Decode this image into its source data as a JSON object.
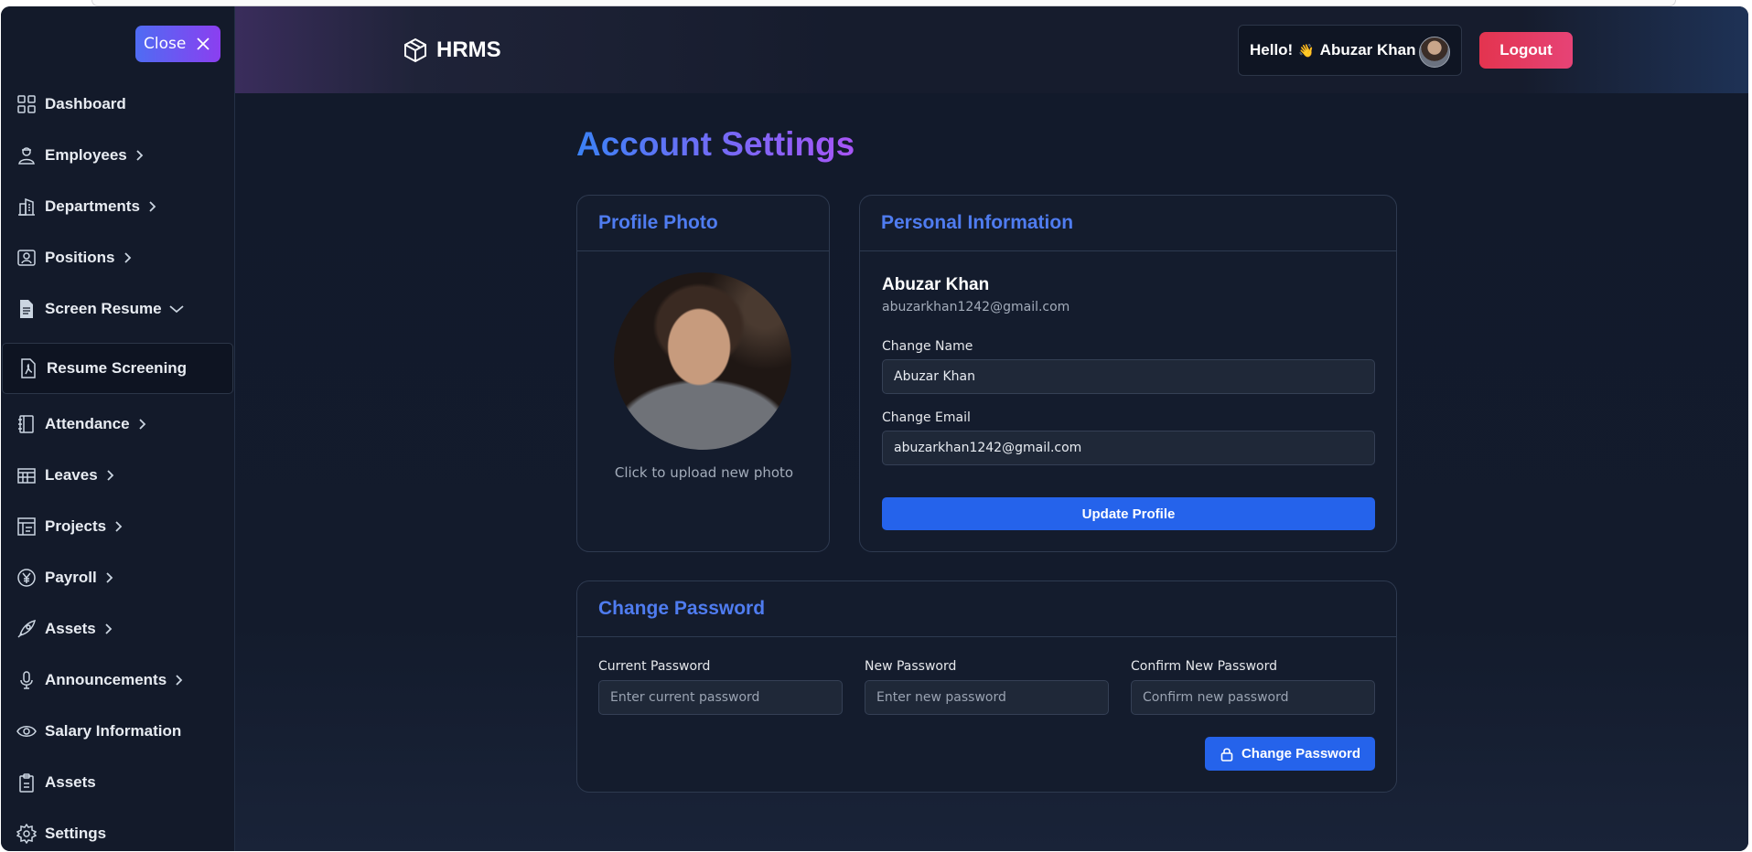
{
  "sidebar": {
    "close_label": "Close",
    "items": [
      {
        "label": "Dashboard",
        "icon": "grid-icon",
        "chevron": ""
      },
      {
        "label": "Employees",
        "icon": "person-icon",
        "chevron": "right"
      },
      {
        "label": "Departments",
        "icon": "building-icon",
        "chevron": "right"
      },
      {
        "label": "Positions",
        "icon": "id-card-icon",
        "chevron": "right"
      },
      {
        "label": "Screen Resume",
        "icon": "document-icon",
        "chevron": "down"
      },
      {
        "label": "Resume Screening",
        "icon": "pdf-icon",
        "chevron": "",
        "active": true
      },
      {
        "label": "Attendance",
        "icon": "notebook-icon",
        "chevron": "right"
      },
      {
        "label": "Leaves",
        "icon": "calendar-icon",
        "chevron": "right"
      },
      {
        "label": "Projects",
        "icon": "project-icon",
        "chevron": "right"
      },
      {
        "label": "Payroll",
        "icon": "yen-icon",
        "chevron": "right"
      },
      {
        "label": "Assets",
        "icon": "rocket-icon",
        "chevron": "right"
      },
      {
        "label": "Announcements",
        "icon": "microphone-icon",
        "chevron": "right"
      },
      {
        "label": "Salary Information",
        "icon": "eye-icon",
        "chevron": ""
      },
      {
        "label": "Assets",
        "icon": "clipboard-icon",
        "chevron": ""
      },
      {
        "label": "Settings",
        "icon": "gear-icon",
        "chevron": ""
      }
    ]
  },
  "header": {
    "brand": "HRMS",
    "greeting": "Hello!",
    "wave": "👋",
    "user_name": "Abuzar Khan",
    "logout_label": "Logout"
  },
  "main": {
    "title": "Account Settings",
    "profile_photo": {
      "title": "Profile Photo",
      "hint": "Click to upload new photo"
    },
    "personal_info": {
      "title": "Personal Information",
      "name": "Abuzar Khan",
      "email": "abuzarkhan1242@gmail.com",
      "change_name_label": "Change Name",
      "change_name_value": "Abuzar Khan",
      "change_email_label": "Change Email",
      "change_email_value": "abuzarkhan1242@gmail.com",
      "update_label": "Update Profile"
    },
    "change_password": {
      "title": "Change Password",
      "current_label": "Current Password",
      "current_placeholder": "Enter current password",
      "new_label": "New Password",
      "new_placeholder": "Enter new password",
      "confirm_label": "Confirm New Password",
      "confirm_placeholder": "Confirm new password",
      "submit_label": "Change Password"
    }
  },
  "colors": {
    "accent_blue": "#2563eb",
    "heading_blue": "#4f7cf0",
    "logout_red": "#e3344f",
    "title_gradient_start": "#3b82f6",
    "title_gradient_end": "#a855f7"
  }
}
